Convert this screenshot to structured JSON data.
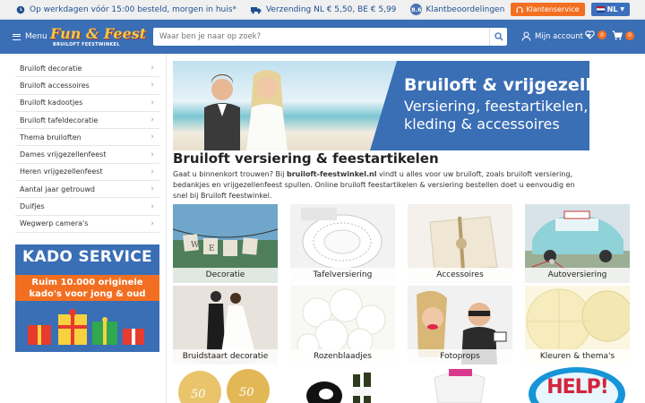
{
  "topbar": {
    "usp1": "Op werkdagen vóór 15:00 besteld, morgen in huis*",
    "usp2": "Verzending NL € 5,50, BE € 5,99",
    "rating": "8.6",
    "reviews": "Klantbeoordelingen",
    "service": "Klantenservice",
    "lang": "NL"
  },
  "header": {
    "menu": "Menu",
    "logo_main": "Fun & Feest",
    "logo_sub": "BRUILOFT FEESTWINKEL",
    "search_placeholder": "Waar ben je naar op zoek?",
    "account": "Mijn account",
    "wishlist_count": "0",
    "cart_count": "0"
  },
  "sidebar": {
    "items": [
      {
        "label": "Bruiloft decoratie"
      },
      {
        "label": "Bruiloft accessoires"
      },
      {
        "label": "Bruiloft kadootjes"
      },
      {
        "label": "Bruiloft tafeldecoratie"
      },
      {
        "label": "Thema bruiloften"
      },
      {
        "label": "Dames vrijgezellenfeest"
      },
      {
        "label": "Heren vrijgezellenfeest"
      },
      {
        "label": "Aantal jaar getrouwd"
      },
      {
        "label": "Duifjes"
      },
      {
        "label": "Wegwerp camera's"
      }
    ],
    "banner_title": "KADO SERVICE",
    "banner_line1": "Ruim 10.000 originele",
    "banner_line2": "kado's voor jong & oud"
  },
  "hero": {
    "line1": "Bruiloft & vrijgezellen",
    "line2": "Versiering, feestartikelen,",
    "line3": "kleding & accessoires"
  },
  "main": {
    "title": "Bruiloft versiering & feestartikelen",
    "intro_before": "Gaat u binnenkort trouwen? Bij ",
    "intro_bold": "bruiloft-feestwinkel.nl",
    "intro_after": " vindt u alles voor uw bruiloft, zoals bruiloft versiering, bedankjes en vrijgezellenfeest spullen. Online bruiloft feestartikelen & versiering bestellen doet u eenvoudig en snel bij Bruiloft feestwinkel."
  },
  "tiles": [
    {
      "label": "Decoratie"
    },
    {
      "label": "Tafelversiering"
    },
    {
      "label": "Accessoires"
    },
    {
      "label": "Autoversiering"
    },
    {
      "label": "Bruidstaart decoratie"
    },
    {
      "label": "Rozenblaadjes"
    },
    {
      "label": "Fotoprops"
    },
    {
      "label": "Kleuren & thema's"
    }
  ],
  "bottom_tiles": {
    "help_sign": "HELP!"
  },
  "colors": {
    "brand_blue": "#3a6eb5",
    "accent_orange": "#f26f21"
  }
}
